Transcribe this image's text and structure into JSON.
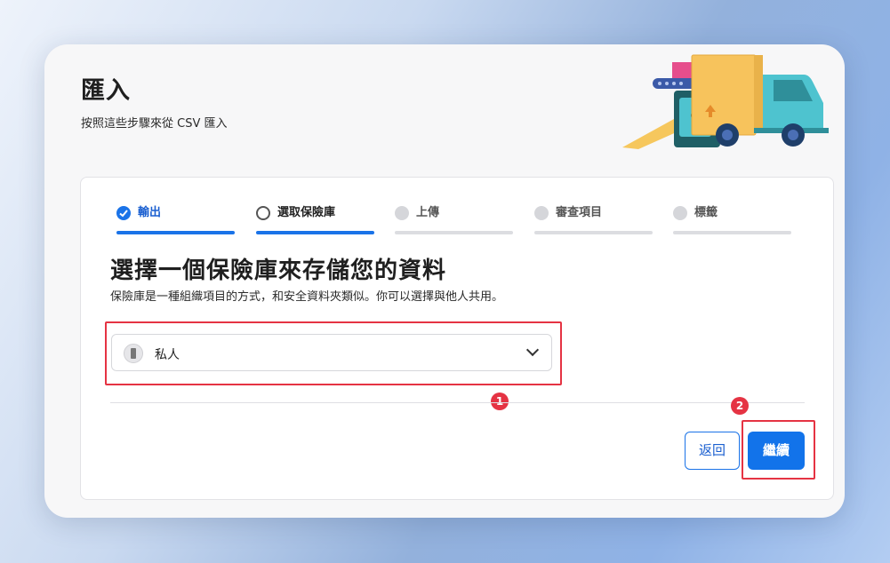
{
  "header": {
    "title": "匯入",
    "subtitle": "按照這些步驟來從 CSV 匯入"
  },
  "steps": [
    {
      "label": "輸出",
      "state": "done"
    },
    {
      "label": "選取保險庫",
      "state": "active"
    },
    {
      "label": "上傳",
      "state": "pending"
    },
    {
      "label": "審查項目",
      "state": "pending"
    },
    {
      "label": "標籤",
      "state": "pending"
    }
  ],
  "main": {
    "heading": "選擇一個保險庫來存儲您的資料",
    "description": "保險庫是一種組織項目的方式，和安全資料夾類似。你可以選擇與他人共用。"
  },
  "vault_select": {
    "selected": "私人"
  },
  "annotations": {
    "badge_1": "1",
    "badge_2": "2"
  },
  "buttons": {
    "back": "返回",
    "continue": "繼續"
  },
  "colors": {
    "accent": "#1a73e8",
    "highlight": "#e53343"
  }
}
